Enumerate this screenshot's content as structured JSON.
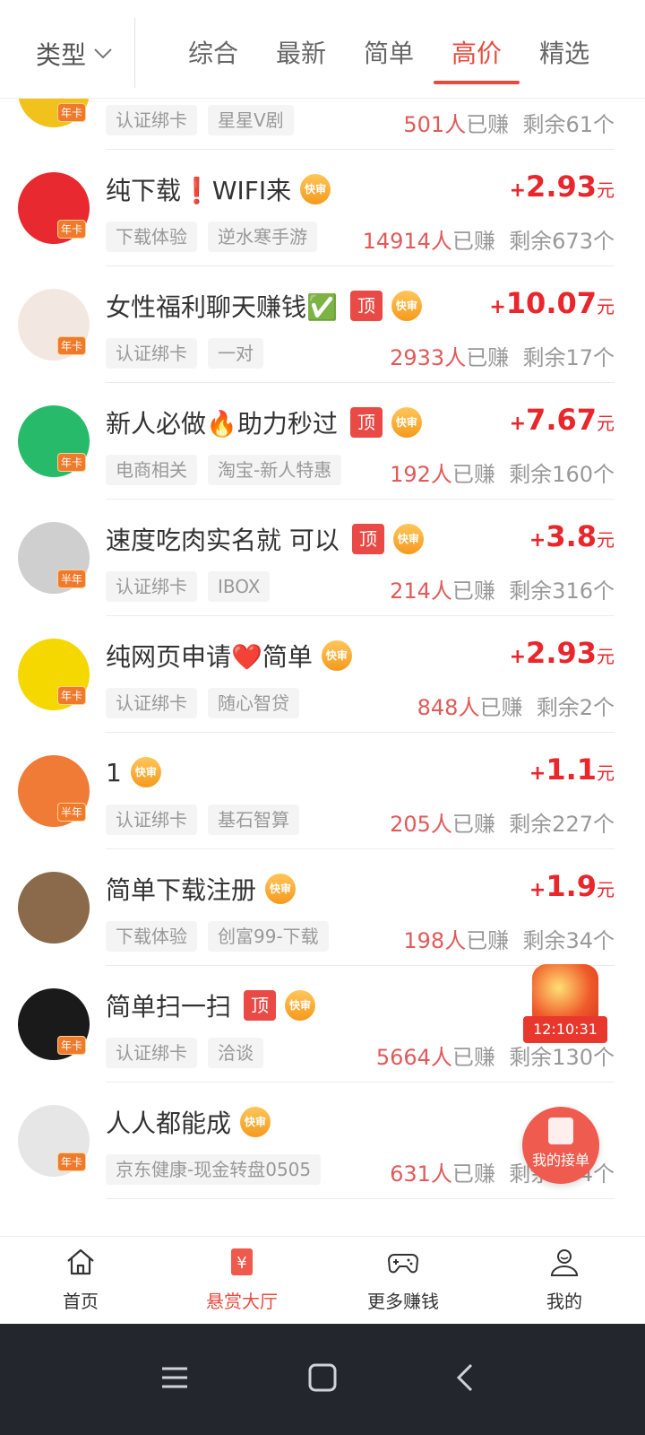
{
  "filter_bar": {
    "type_label": "类型",
    "tabs": [
      {
        "label": "综合",
        "active": false
      },
      {
        "label": "最新",
        "active": false
      },
      {
        "label": "简单",
        "active": false
      },
      {
        "label": "高价",
        "active": true
      },
      {
        "label": "精选",
        "active": false
      }
    ]
  },
  "tasks": [
    {
      "title": "",
      "top": false,
      "fast": false,
      "chips": [
        "认证绑卡",
        "星星V剧"
      ],
      "price": "",
      "earned": "501",
      "remaining": "剩余61个",
      "avatar_badge": "年卡",
      "avatar_color": "#f1c21b"
    },
    {
      "title": "纯下载❗WIFI来",
      "top": false,
      "fast": true,
      "chips": [
        "下载体验",
        "逆水寒手游"
      ],
      "price": "2.93",
      "earned": "14914",
      "remaining": "剩余673个",
      "avatar_badge": "年卡",
      "avatar_color": "#e8292f"
    },
    {
      "title": "女性福利聊天赚钱✅",
      "top": true,
      "fast": true,
      "chips": [
        "认证绑卡",
        "一对"
      ],
      "price": "10.07",
      "earned": "2933",
      "remaining": "剩余17个",
      "avatar_badge": "年卡",
      "avatar_color": "#f3e7e2"
    },
    {
      "title": "新人必做🔥助力秒过",
      "top": true,
      "fast": true,
      "chips": [
        "电商相关",
        "淘宝-新人特惠"
      ],
      "price": "7.67",
      "earned": "192",
      "remaining": "剩余160个",
      "avatar_badge": "年卡",
      "avatar_color": "#27ba6b"
    },
    {
      "title": "速度吃肉实名就 可以",
      "top": true,
      "fast": true,
      "chips": [
        "认证绑卡",
        "IBOX"
      ],
      "price": "3.8",
      "earned": "214",
      "remaining": "剩余316个",
      "avatar_badge": "半年",
      "avatar_color": "#cfcfcf"
    },
    {
      "title": "纯网页申请❤️简单",
      "top": false,
      "fast": true,
      "chips": [
        "认证绑卡",
        "随心智贷"
      ],
      "price": "2.93",
      "earned": "848",
      "remaining": "剩余2个",
      "avatar_badge": "年卡",
      "avatar_color": "#f5d800"
    },
    {
      "title": "1",
      "top": false,
      "fast": true,
      "chips": [
        "认证绑卡",
        "基石智算"
      ],
      "price": "1.1",
      "earned": "205",
      "remaining": "剩余227个",
      "avatar_badge": "半年",
      "avatar_color": "#f07b36"
    },
    {
      "title": "简单下载注册",
      "top": false,
      "fast": true,
      "chips": [
        "下载体验",
        "创富99-下载"
      ],
      "price": "1.9",
      "earned": "198",
      "remaining": "剩余34个",
      "avatar_badge": "",
      "avatar_color": "#8a6a4a"
    },
    {
      "title": "简单扫一扫",
      "top": true,
      "fast": true,
      "chips": [
        "认证绑卡",
        "洽谈"
      ],
      "price": "",
      "earned": "5664",
      "remaining": "剩余130个",
      "avatar_badge": "年卡",
      "avatar_color": "#1a1a1a"
    },
    {
      "title": "人人都能成",
      "top": false,
      "fast": true,
      "chips": [
        "京东健康-现金转盘0505"
      ],
      "price": "",
      "earned": "631",
      "remaining": "剩余434个",
      "avatar_badge": "年卡",
      "avatar_color": "#e6e6e6"
    }
  ],
  "labels": {
    "top": "顶",
    "fast": "快审",
    "currency": "元",
    "plus": "+",
    "earned_suffix": "已赚",
    "people": "人"
  },
  "floating": {
    "timer": "12:10:31",
    "my_orders": "我的接单"
  },
  "bottom_nav": [
    {
      "label": "首页",
      "icon": "home-icon",
      "active": false
    },
    {
      "label": "悬赏大厅",
      "icon": "reward-hall-icon",
      "active": true
    },
    {
      "label": "更多赚钱",
      "icon": "gamepad-icon",
      "active": false
    },
    {
      "label": "我的",
      "icon": "user-icon",
      "active": false
    }
  ],
  "colors": {
    "accent": "#e84a3c",
    "price": "#e8262c"
  }
}
